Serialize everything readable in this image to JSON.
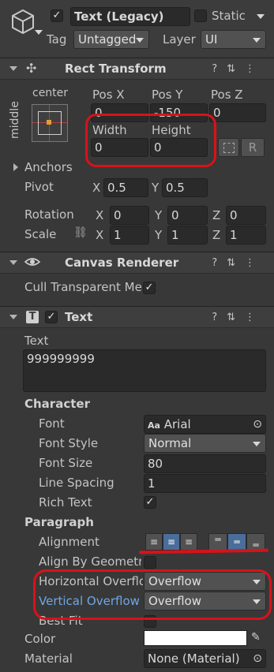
{
  "gameobject": {
    "name": "Text (Legacy)",
    "static_label": "Static",
    "tag_label": "Tag",
    "tag_value": "Untagged",
    "layer_label": "Layer",
    "layer_value": "UI"
  },
  "rect_transform": {
    "title": "Rect Transform",
    "anchor_preset_h": "center",
    "anchor_preset_v": "middle",
    "pos_x_label": "Pos X",
    "pos_y_label": "Pos Y",
    "pos_z_label": "Pos Z",
    "pos_x": "0",
    "pos_y": "-150",
    "pos_z": "0",
    "width_label": "Width",
    "height_label": "Height",
    "width": "0",
    "height": "0",
    "r_button": "R",
    "anchors_label": "Anchors",
    "pivot_label": "Pivot",
    "pivot_x": "0.5",
    "pivot_y": "0.5",
    "rotation_label": "Rotation",
    "rot_x": "0",
    "rot_y": "0",
    "rot_z": "0",
    "scale_label": "Scale",
    "scale_x": "1",
    "scale_y": "1",
    "scale_z": "1",
    "x": "X",
    "y": "Y",
    "z": "Z"
  },
  "canvas_renderer": {
    "title": "Canvas Renderer",
    "cull_label": "Cull Transparent Me:"
  },
  "text_component": {
    "title": "Text",
    "text_label": "Text",
    "text_value": "999999999",
    "character_label": "Character",
    "font_label": "Font",
    "font_value": "Arial",
    "font_prefix": "Aa",
    "font_style_label": "Font Style",
    "font_style_value": "Normal",
    "font_size_label": "Font Size",
    "font_size_value": "80",
    "line_spacing_label": "Line Spacing",
    "line_spacing_value": "1",
    "rich_text_label": "Rich Text",
    "paragraph_label": "Paragraph",
    "alignment_label": "Alignment",
    "align_geometry_label": "Align By Geometry",
    "h_overflow_label": "Horizontal Overflo",
    "h_overflow_value": "Overflow",
    "v_overflow_label": "Vertical Overflow",
    "v_overflow_value": "Overflow",
    "best_fit_label": "Best Fit",
    "color_label": "Color",
    "material_label": "Material",
    "material_value": "None (Material)"
  },
  "colors": {
    "highlight": "#d8121a",
    "link_label": "#6ea7e6",
    "selected_button": "#4a6d9a"
  }
}
